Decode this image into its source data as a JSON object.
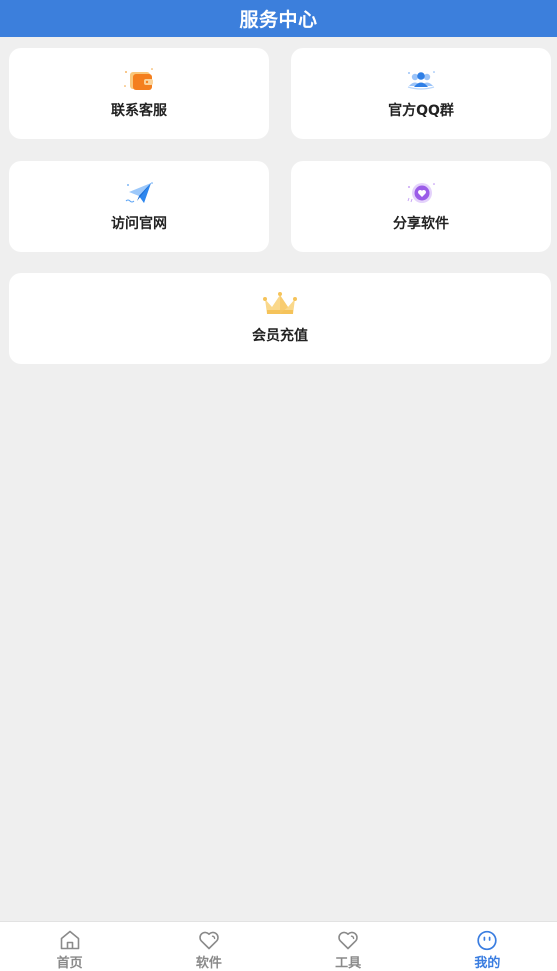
{
  "header": {
    "title": "服务中心"
  },
  "services": [
    {
      "label": "联系客服",
      "icon": "wallet-icon"
    },
    {
      "label": "官方QQ群",
      "icon": "group-users-icon"
    },
    {
      "label": "访问官网",
      "icon": "paper-plane-icon"
    },
    {
      "label": "分享软件",
      "icon": "heart-badge-icon"
    },
    {
      "label": "会员充值",
      "icon": "crown-icon"
    }
  ],
  "tabbar": {
    "tabs": [
      {
        "label": "首页",
        "icon": "home-icon",
        "active": false
      },
      {
        "label": "软件",
        "icon": "heart-icon",
        "active": false
      },
      {
        "label": "工具",
        "icon": "heart-icon",
        "active": false
      },
      {
        "label": "我的",
        "icon": "face-icon",
        "active": true
      }
    ]
  },
  "colors": {
    "header_bg": "#3c7fdc",
    "page_bg": "#efefef",
    "active_tab": "#3a7de0",
    "inactive_tab": "#8a8a8a"
  }
}
